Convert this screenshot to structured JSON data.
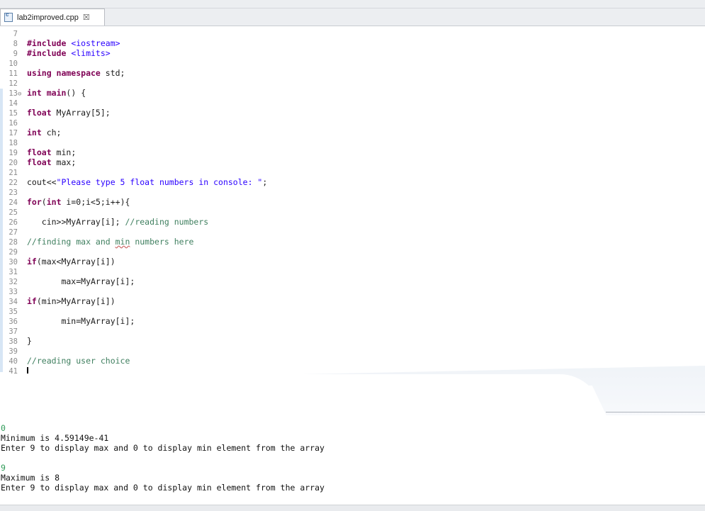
{
  "tab": {
    "filename": "lab2improved.cpp",
    "close_glyph": "☒",
    "icon": "c-file-icon"
  },
  "editor": {
    "lines": [
      {
        "n": "7",
        "tokens": []
      },
      {
        "n": "8",
        "tokens": [
          {
            "c": "kw",
            "t": "#include "
          },
          {
            "c": "inc",
            "t": "<iostream>"
          }
        ]
      },
      {
        "n": "9",
        "tokens": [
          {
            "c": "kw",
            "t": "#include "
          },
          {
            "c": "inc",
            "t": "<limits>"
          }
        ]
      },
      {
        "n": "10",
        "tokens": []
      },
      {
        "n": "11",
        "tokens": [
          {
            "c": "kw",
            "t": "using namespace"
          },
          {
            "c": "",
            "t": " std;"
          }
        ]
      },
      {
        "n": "12",
        "tokens": []
      },
      {
        "n": "13",
        "fold": "⊖",
        "tokens": [
          {
            "c": "kw",
            "t": "int"
          },
          {
            "c": "",
            "t": " "
          },
          {
            "c": "kw",
            "t": "main"
          },
          {
            "c": "",
            "t": "() {"
          }
        ]
      },
      {
        "n": "14",
        "tokens": []
      },
      {
        "n": "15",
        "tokens": [
          {
            "c": "kw",
            "t": "float"
          },
          {
            "c": "",
            "t": " MyArray[5];"
          }
        ]
      },
      {
        "n": "16",
        "tokens": []
      },
      {
        "n": "17",
        "tokens": [
          {
            "c": "kw",
            "t": "int"
          },
          {
            "c": "",
            "t": " ch;"
          }
        ]
      },
      {
        "n": "18",
        "tokens": []
      },
      {
        "n": "19",
        "tokens": [
          {
            "c": "kw",
            "t": "float"
          },
          {
            "c": "",
            "t": " min;"
          }
        ]
      },
      {
        "n": "20",
        "tokens": [
          {
            "c": "kw",
            "t": "float"
          },
          {
            "c": "",
            "t": " max;"
          }
        ]
      },
      {
        "n": "21",
        "tokens": []
      },
      {
        "n": "22",
        "tokens": [
          {
            "c": "",
            "t": "cout<<"
          },
          {
            "c": "str",
            "t": "\"Please type 5 float numbers in console: \""
          },
          {
            "c": "",
            "t": ";"
          }
        ]
      },
      {
        "n": "23",
        "tokens": []
      },
      {
        "n": "24",
        "tokens": [
          {
            "c": "kw",
            "t": "for"
          },
          {
            "c": "",
            "t": "("
          },
          {
            "c": "kw",
            "t": "int"
          },
          {
            "c": "",
            "t": " i=0;i<5;i++){"
          }
        ]
      },
      {
        "n": "25",
        "tokens": []
      },
      {
        "n": "26",
        "tokens": [
          {
            "c": "",
            "t": "   cin>>MyArray[i]; "
          },
          {
            "c": "cmt",
            "t": "//reading numbers"
          }
        ]
      },
      {
        "n": "27",
        "tokens": []
      },
      {
        "n": "28",
        "tokens": [
          {
            "c": "cmt",
            "t": "//finding max and "
          },
          {
            "c": "cmt err",
            "t": "min"
          },
          {
            "c": "cmt",
            "t": " numbers here"
          }
        ]
      },
      {
        "n": "29",
        "tokens": []
      },
      {
        "n": "30",
        "tokens": [
          {
            "c": "kw",
            "t": "if"
          },
          {
            "c": "",
            "t": "(max<MyArray[i])"
          }
        ]
      },
      {
        "n": "31",
        "tokens": []
      },
      {
        "n": "32",
        "tokens": [
          {
            "c": "",
            "t": "       max=MyArray[i];"
          }
        ]
      },
      {
        "n": "33",
        "tokens": []
      },
      {
        "n": "34",
        "tokens": [
          {
            "c": "kw",
            "t": "if"
          },
          {
            "c": "",
            "t": "(min>MyArray[i])"
          }
        ]
      },
      {
        "n": "35",
        "tokens": []
      },
      {
        "n": "36",
        "tokens": [
          {
            "c": "",
            "t": "       min=MyArray[i];"
          }
        ]
      },
      {
        "n": "37",
        "tokens": []
      },
      {
        "n": "38",
        "tokens": [
          {
            "c": "",
            "t": "}"
          }
        ]
      },
      {
        "n": "39",
        "tokens": []
      },
      {
        "n": "40",
        "tokens": [
          {
            "c": "cmt",
            "t": "//reading user choice"
          }
        ]
      },
      {
        "n": "41",
        "tokens": [],
        "caret": true
      }
    ]
  },
  "console": {
    "lines": [
      {
        "text": "0",
        "input": true
      },
      {
        "text": "Minimum is 4.59149e-41"
      },
      {
        "text": "Enter 9 to display max and 0 to display min element from the array"
      },
      {
        "text": ""
      },
      {
        "text": "9",
        "input": true
      },
      {
        "text": "Maximum is 8"
      },
      {
        "text": "Enter 9 to display max and 0 to display min element from the array"
      }
    ]
  }
}
